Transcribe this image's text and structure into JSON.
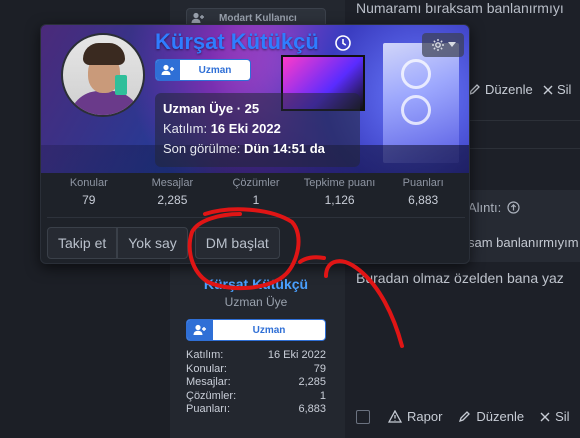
{
  "background": {
    "top_badge": "Modart Kullanıcı",
    "quoted_text": "Numaramı bıraksam banlanırmıyı",
    "actions_top": [
      "Düzenle",
      "Sil"
    ],
    "quote_head": "Alıntı:",
    "quote_body": "sam banlanırmıyım",
    "reply_text": "Buradan olmaz özelden bana yaz",
    "actions_bottom": [
      "Rapor",
      "Düzenle",
      "Sil"
    ]
  },
  "column_user": {
    "name": "Kürşat Kütükçü",
    "title": "Uzman Üye",
    "badge": "Uzman",
    "stats": [
      {
        "label": "Katılım:",
        "value": "16 Eki 2022"
      },
      {
        "label": "Konular:",
        "value": "79"
      },
      {
        "label": "Mesajlar:",
        "value": "2,285"
      },
      {
        "label": "Çözümler:",
        "value": "1"
      },
      {
        "label": "Puanları:",
        "value": "6,883"
      }
    ]
  },
  "card": {
    "name": "Kürşat Kütükçü",
    "badge": "Uzman",
    "role_line": "Uzman Üye · 25",
    "joined_label": "Katılım:",
    "joined_value": "16 Eki 2022",
    "last_seen_label": "Son görülme:",
    "last_seen_value": "Dün 14:51 da",
    "stats": [
      {
        "label": "Konular",
        "value": "79"
      },
      {
        "label": "Mesajlar",
        "value": "2,285"
      },
      {
        "label": "Çözümler",
        "value": "1"
      },
      {
        "label": "Tepkime puanı",
        "value": "1,126"
      },
      {
        "label": "Puanları",
        "value": "6,883"
      }
    ],
    "buttons": {
      "follow": "Takip et",
      "ignore": "Yok say",
      "dm": "DM başlat"
    }
  },
  "colors": {
    "accent": "#2f7dff",
    "annotation": "#e01515"
  },
  "icons": [
    "add-user-icon",
    "clock-icon",
    "gear-icon",
    "chevron-down-icon",
    "warning-icon",
    "pencil-icon",
    "close-icon",
    "arrow-up-circle-icon"
  ]
}
